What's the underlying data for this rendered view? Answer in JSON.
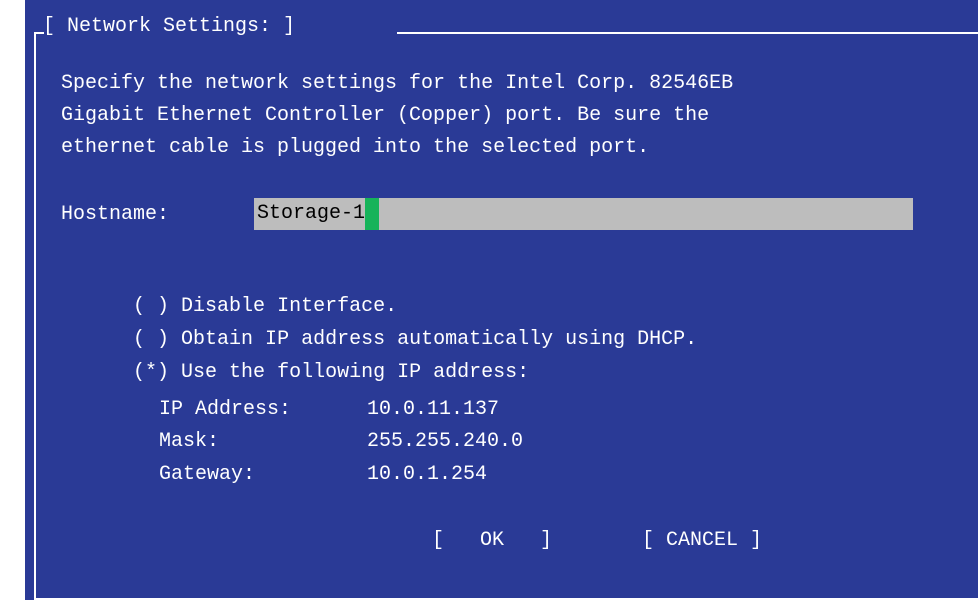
{
  "dialog": {
    "title": "[ Network Settings: ]",
    "description_lines": [
      "Specify the network settings for the Intel Corp. 82546EB",
      "Gigabit Ethernet Controller (Copper) port. Be sure the",
      "ethernet cable is plugged into the selected port."
    ],
    "hostname": {
      "label": "Hostname:",
      "value": "Storage-1"
    },
    "options": [
      {
        "marker": "( )",
        "label": "Disable Interface."
      },
      {
        "marker": "( )",
        "label": "Obtain IP address automatically using DHCP."
      },
      {
        "marker": "(*)",
        "label": "Use the following IP address:"
      }
    ],
    "ip_settings": {
      "ip_address_label": "IP Address:",
      "ip_address": "10.0.11.137",
      "mask_label": "Mask:",
      "mask": "255.255.240.0",
      "gateway_label": "Gateway:",
      "gateway": "10.0.1.254"
    },
    "buttons": {
      "ok": "[   OK   ]",
      "cancel": "[ CANCEL ]"
    }
  },
  "colors": {
    "background": "#2a3a96",
    "text": "#ffffff",
    "field": "#bdbdbd",
    "cursor": "#16b35a"
  }
}
